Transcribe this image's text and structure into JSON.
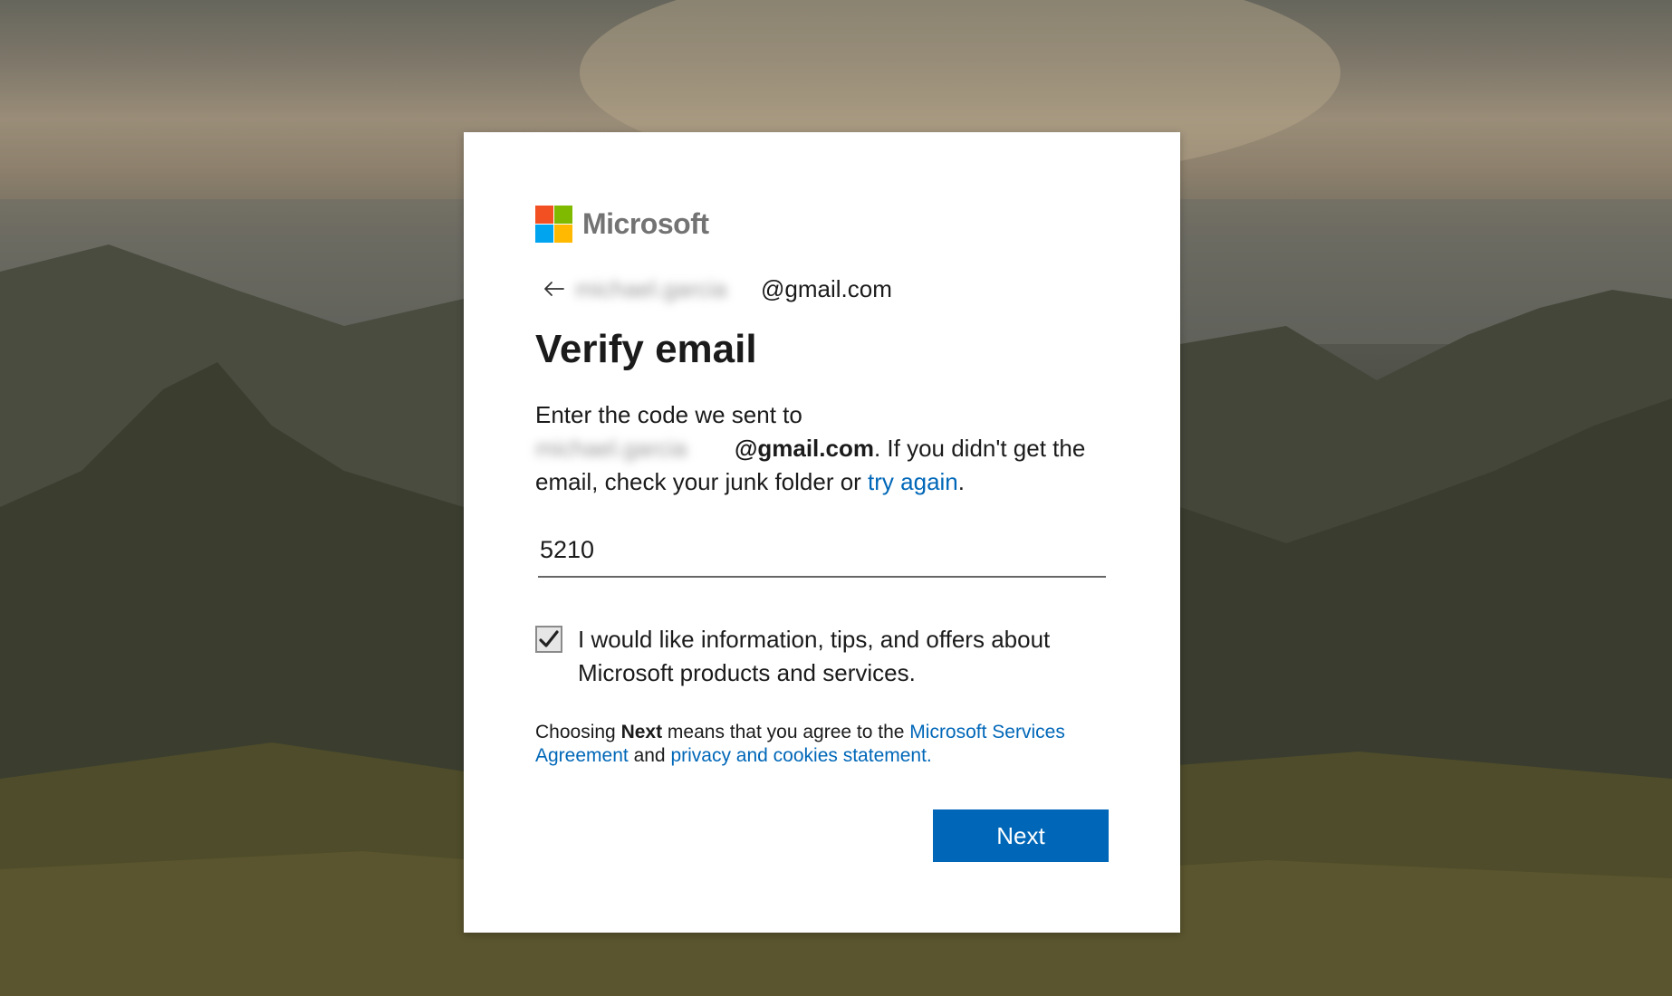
{
  "brand": {
    "name": "Microsoft",
    "colors": {
      "red": "#f25022",
      "green": "#7fba00",
      "blue": "#00a4ef",
      "yellow": "#ffb900"
    }
  },
  "identity": {
    "email_redacted": "michael.garcia",
    "email_domain": "@gmail.com"
  },
  "page": {
    "title": "Verify email"
  },
  "instructions": {
    "line1": "Enter the code we sent to",
    "email_redacted": "michael.garcia",
    "email_domain": "@gmail.com",
    "after_email": ". If you didn't get the email, check your junk folder or ",
    "try_again": "try again",
    "end": "."
  },
  "code_input": {
    "value": "5210"
  },
  "marketing_opt_in": {
    "checked": true,
    "label": "I would like information, tips, and offers about Microsoft products and services."
  },
  "terms": {
    "prefix": "Choosing ",
    "next_word": "Next",
    "middle": " means that you agree to the ",
    "agreement_link": "Microsoft Services Agreement",
    "and": " and ",
    "privacy_link": "privacy and cookies statement."
  },
  "actions": {
    "next_label": "Next",
    "accent": "#0067b8"
  }
}
